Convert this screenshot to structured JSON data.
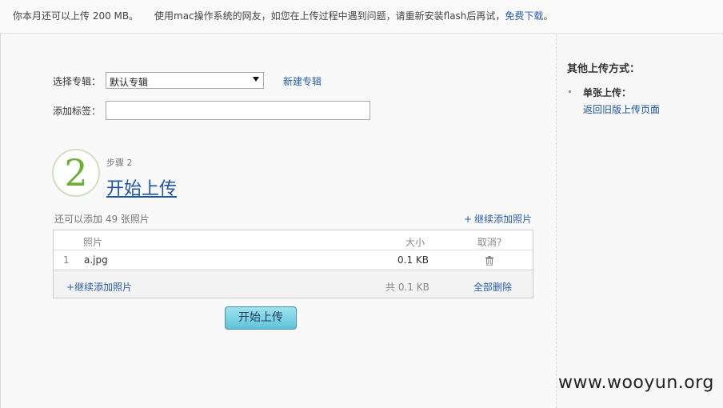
{
  "topbar": {
    "quota": "你本月还可以上传 200 MB。",
    "mac_note": "使用mac操作系统的网友，如您在上传过程中遇到问题，请重新安装flash后再试，",
    "mac_link": "免费下载",
    "mac_suffix": "。"
  },
  "form": {
    "album_label": "选择专辑：",
    "album_value": "默认专辑",
    "new_album": "新建专辑",
    "tag_label": "添加标签：",
    "tag_value": ""
  },
  "step": {
    "number": "2",
    "label": "步骤 2",
    "title": "开始上传"
  },
  "upload": {
    "remaining": "还可以添加 49 张照片",
    "add_more_top": "继续添加照片",
    "columns": {
      "photo": "照片",
      "size": "大小",
      "cancel": "取消?"
    },
    "rows": [
      {
        "index": "1",
        "name": "a.jpg",
        "size": "0.1 KB"
      }
    ],
    "footer": {
      "add_more": "继续添加照片",
      "total": "共 0.1 KB",
      "delete_all": "全部删除"
    },
    "start_button": "开始上传"
  },
  "sidebar": {
    "title": "其他上传方式：",
    "single_label": "单张上传：",
    "old_version_link": "返回旧版上传页面"
  },
  "watermark": "www.wooyun.org",
  "colors": {
    "link": "#2a5caa",
    "step_green": "#6ab035",
    "button": "#5fc2d8"
  }
}
